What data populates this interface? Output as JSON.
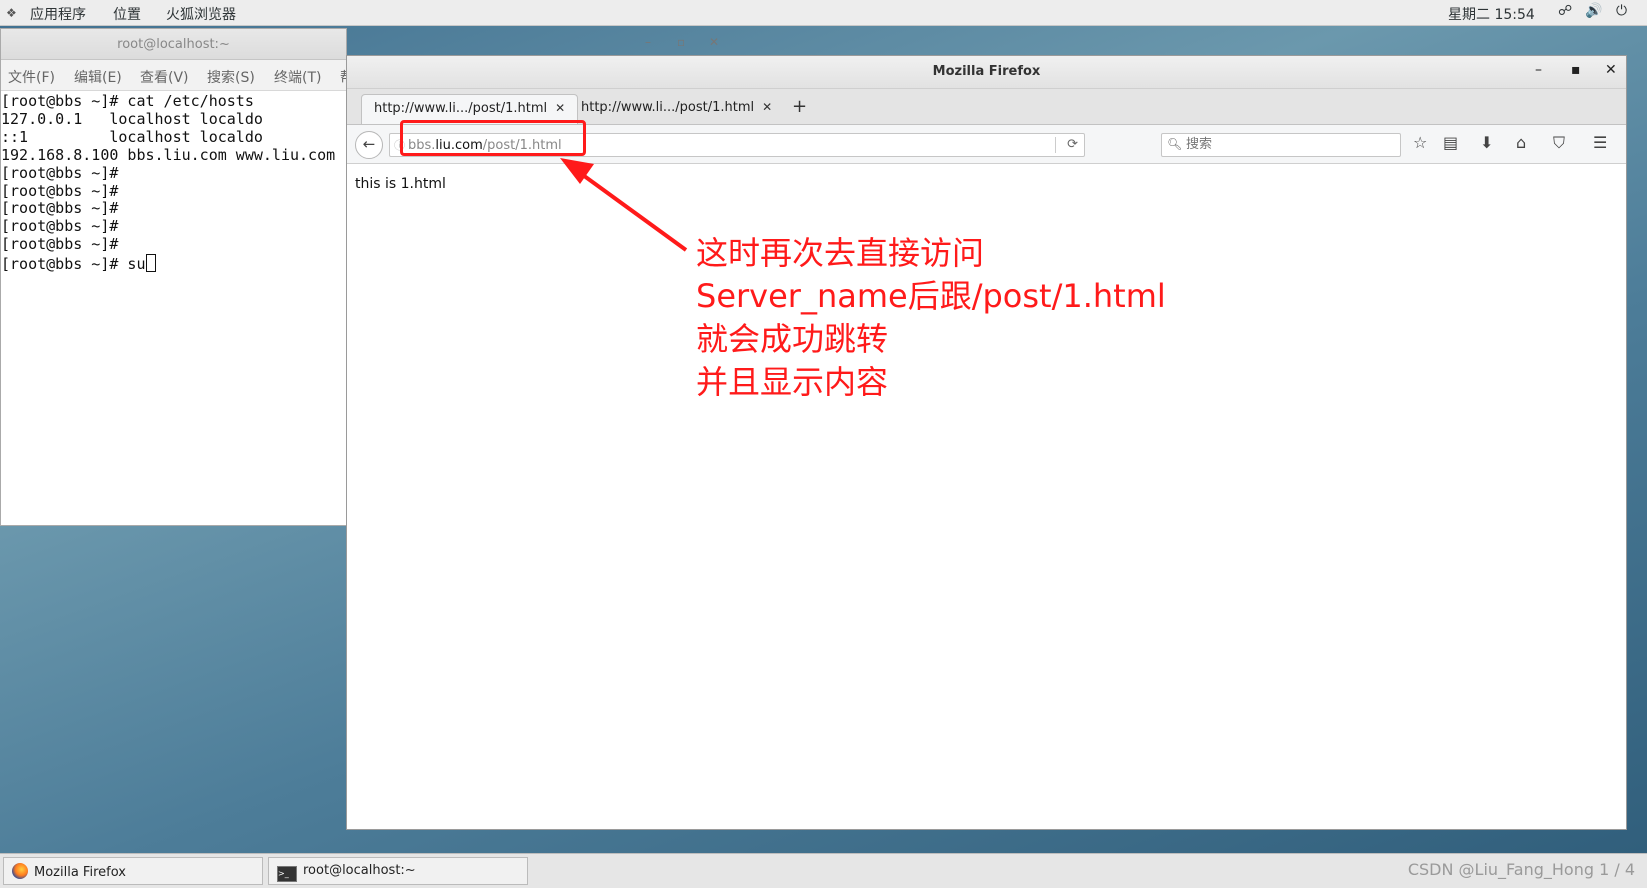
{
  "top_panel": {
    "applications": "应用程序",
    "places": "位置",
    "firefox": "火狐浏览器",
    "clock": "星期二 15:54"
  },
  "terminal": {
    "title": "root@localhost:~",
    "menu": [
      "文件(F)",
      "编辑(E)",
      "查看(V)",
      "搜索(S)",
      "终端(T)",
      "帮"
    ],
    "lines": [
      "[root@bbs ~]# cat /etc/hosts",
      "127.0.0.1   localhost localdo",
      "::1         localhost localdo",
      "192.168.8.100 bbs.liu.com www.liu.com",
      "[root@bbs ~]#",
      "[root@bbs ~]#",
      "[root@bbs ~]#",
      "[root@bbs ~]#",
      "[root@bbs ~]#",
      "[root@bbs ~]# su"
    ]
  },
  "firefox": {
    "title": "Mozilla Firefox",
    "tabs": [
      {
        "label": "http://www.li.../post/1.html"
      },
      {
        "label": "http://www.li.../post/1.html"
      }
    ],
    "url_domain_prefix": "bbs.",
    "url_domain": "liu.com",
    "url_path": "/post/1.html",
    "search_placeholder": "搜索",
    "page_text": "this is 1.html"
  },
  "annotation": {
    "lines": [
      "这时再次去直接访问",
      "Server_name后跟/post/1.html",
      "就会成功跳转",
      "并且显示内容"
    ],
    "color": "#ff1a1a"
  },
  "taskbar": {
    "items": [
      "Mozilla Firefox",
      "root@localhost:~"
    ],
    "watermark": "CSDN @Liu_Fang_Hong",
    "pager": "1 / 4"
  }
}
